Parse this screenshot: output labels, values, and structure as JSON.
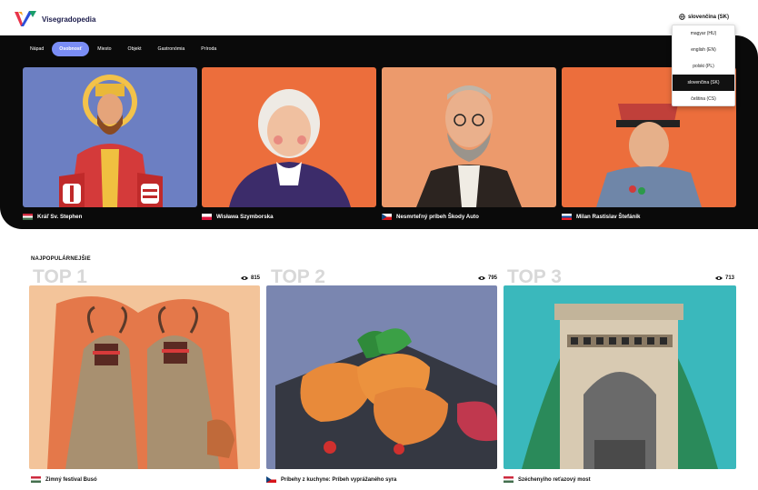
{
  "header": {
    "logo_text": "Visegradopedia",
    "language_button": "slovenčina (SK)"
  },
  "language_menu": {
    "items": [
      {
        "label": "magyar (HU)",
        "selected": false
      },
      {
        "label": "english (EN)",
        "selected": false
      },
      {
        "label": "polski (PL)",
        "selected": false
      },
      {
        "label": "slovenčina (SK)",
        "selected": true
      },
      {
        "label": "čeština (CS)",
        "selected": false
      }
    ]
  },
  "tabs": [
    {
      "label": "Nápad",
      "active": false
    },
    {
      "label": "Osobnosť",
      "active": true
    },
    {
      "label": "Miesto",
      "active": false
    },
    {
      "label": "Objekt",
      "active": false
    },
    {
      "label": "Gastronómia",
      "active": false
    },
    {
      "label": "Príroda",
      "active": false
    }
  ],
  "hero_cards": [
    {
      "title": "Kráľ Sv. Stephen",
      "flag": "HU"
    },
    {
      "title": "Wisława Szymborska",
      "flag": "PL"
    },
    {
      "title": "Nesmrteľný príbeh Škody Auto",
      "flag": "CZ"
    },
    {
      "title": "Milan Rastislav Štefánik",
      "flag": "SK"
    }
  ],
  "popular": {
    "title": "NAJPOPULÁRNEJŠIE",
    "items": [
      {
        "rank": "TOP 1",
        "views": "815",
        "title": "Zimný festival Busó",
        "flag": "HU"
      },
      {
        "rank": "TOP 2",
        "views": "795",
        "title": "Príbehy z kuchyne: Príbeh vyprážaného syra",
        "flag": "CZ"
      },
      {
        "rank": "TOP 3",
        "views": "713",
        "title": "Széchenyiho reťazový most",
        "flag": "HU"
      }
    ]
  },
  "colors": {
    "accent_tab": "#7a8df5",
    "hero_bg": "#0a0a0a"
  }
}
